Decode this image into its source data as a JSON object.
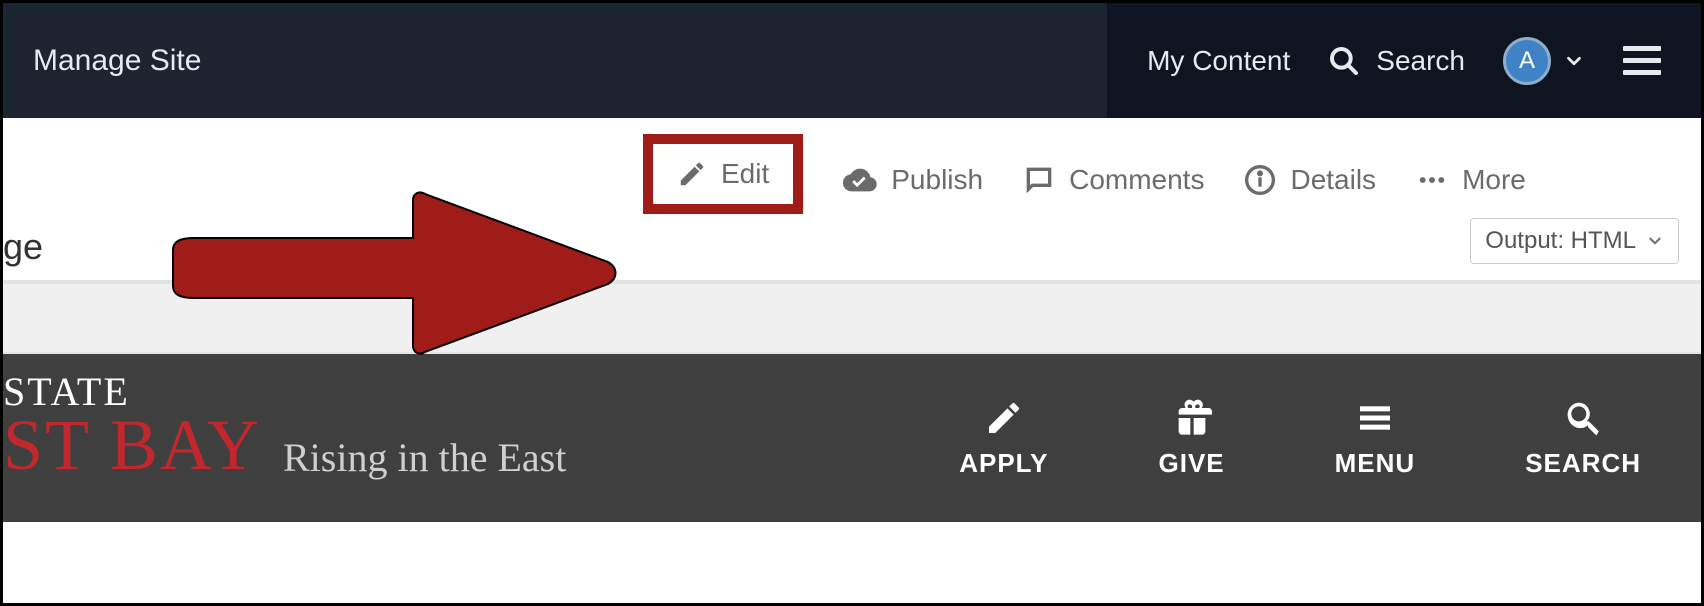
{
  "topbar": {
    "manage_site": "Manage Site",
    "my_content": "My Content",
    "search_label": "Search",
    "avatar_letter": "A"
  },
  "actions": {
    "edit": "Edit",
    "publish": "Publish",
    "comments": "Comments",
    "details": "Details",
    "more": "More"
  },
  "page_title_fragment": "ge",
  "output_selector": "Output: HTML",
  "siteheader": {
    "logo_state": "STATE",
    "logo_stbay": "ST BAY",
    "tagline": "Rising in the East",
    "nav": {
      "apply": "APPLY",
      "give": "GIVE",
      "menu": "MENU",
      "search": "SEARCH"
    }
  },
  "colors": {
    "annotation_red": "#a01c19",
    "brand_red": "#c1272d",
    "topbar_bg": "#1c2430",
    "topbar_right_bg": "#0f1520",
    "siteheader_bg": "#3f3f3f"
  }
}
